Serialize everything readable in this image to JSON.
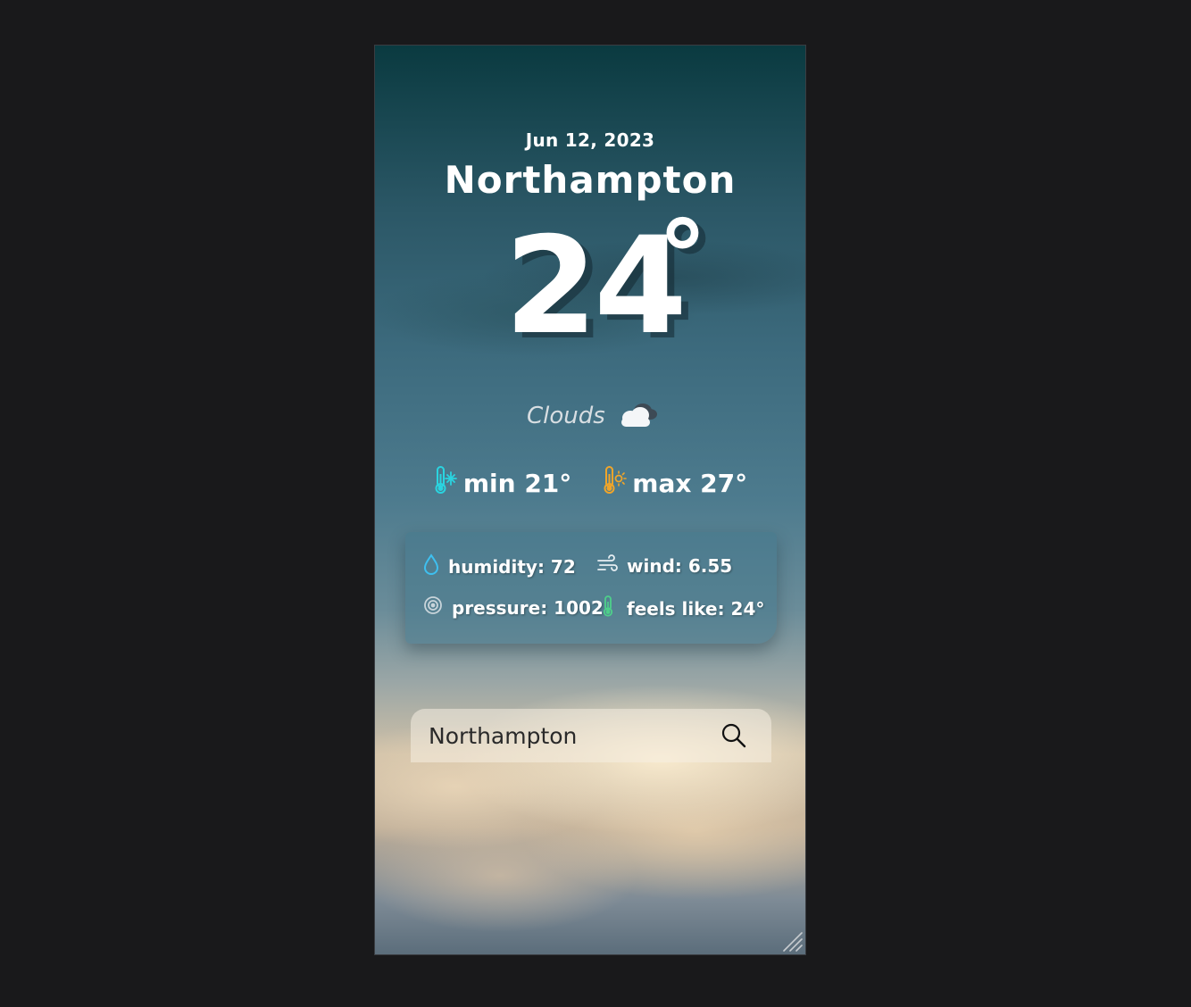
{
  "weather": {
    "date": "Jun 12, 2023",
    "city": "Northampton",
    "temperature": "24",
    "degree_symbol": "°",
    "condition": "Clouds",
    "condition_icon": "cloud-icon",
    "min_label": "min 21°",
    "max_label": "max 27°",
    "min_icon": "thermometer-cold-icon",
    "max_icon": "thermometer-hot-icon"
  },
  "details": {
    "humidity": "humidity: 72",
    "wind": "wind: 6.55",
    "pressure": "pressure: 1002",
    "feels_like": "feels like: 24°",
    "icons": [
      "humidity-drop-icon",
      "wind-icon",
      "pressure-icon",
      "thermometer-icon"
    ]
  },
  "search": {
    "value": "Northampton",
    "icon": "search-icon"
  },
  "colors": {
    "background": "#19191b",
    "cold_accent": "#2ad4e0",
    "hot_accent": "#f0a52a",
    "humidity_accent": "#3ec0f0",
    "feels_accent": "#4ed08a",
    "text": "#ffffff"
  }
}
